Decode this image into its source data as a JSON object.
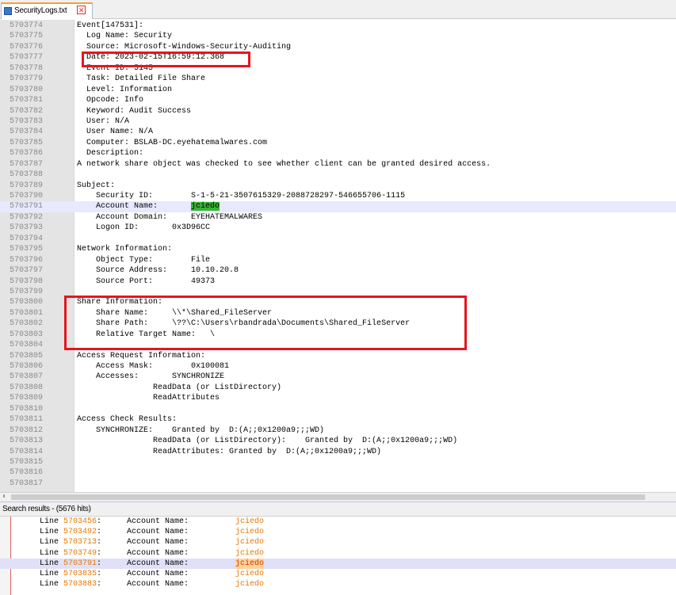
{
  "tab": {
    "filename": "SecurityLogs.txt",
    "close_glyph": "✕"
  },
  "editor": {
    "lines": [
      {
        "num": "5703774",
        "text": "Event[147531]:"
      },
      {
        "num": "5703775",
        "text": "  Log Name: Security"
      },
      {
        "num": "5703776",
        "text": "  Source: Microsoft-Windows-Security-Auditing"
      },
      {
        "num": "5703777",
        "text": "  Date: 2023-02-15T16:59:12.368"
      },
      {
        "num": "5703778",
        "text": "  Event ID: 5145"
      },
      {
        "num": "5703779",
        "text": "  Task: Detailed File Share"
      },
      {
        "num": "5703780",
        "text": "  Level: Information"
      },
      {
        "num": "5703781",
        "text": "  Opcode: Info"
      },
      {
        "num": "5703782",
        "text": "  Keyword: Audit Success"
      },
      {
        "num": "5703783",
        "text": "  User: N/A"
      },
      {
        "num": "5703784",
        "text": "  User Name: N/A"
      },
      {
        "num": "5703785",
        "text": "  Computer: BSLAB-DC.eyehatemalwares.com"
      },
      {
        "num": "5703786",
        "text": "  Description:"
      },
      {
        "num": "5703787",
        "text": "A network share object was checked to see whether client can be granted desired access."
      },
      {
        "num": "5703788",
        "text": ""
      },
      {
        "num": "5703789",
        "text": "Subject:"
      },
      {
        "num": "5703790",
        "text": "    Security ID:        S-1-5-21-3507615329-2088728297-546655706-1115"
      },
      {
        "num": "5703791",
        "text": "    Account Name:       ",
        "token": "jciedo",
        "highlight": true
      },
      {
        "num": "5703792",
        "text": "    Account Domain:     EYEHATEMALWARES"
      },
      {
        "num": "5703793",
        "text": "    Logon ID:       0x3D96CC"
      },
      {
        "num": "5703794",
        "text": ""
      },
      {
        "num": "5703795",
        "text": "Network Information:"
      },
      {
        "num": "5703796",
        "text": "    Object Type:        File"
      },
      {
        "num": "5703797",
        "text": "    Source Address:     10.10.20.8"
      },
      {
        "num": "5703798",
        "text": "    Source Port:        49373"
      },
      {
        "num": "5703799",
        "text": ""
      },
      {
        "num": "5703800",
        "text": "Share Information:"
      },
      {
        "num": "5703801",
        "text": "    Share Name:     \\\\*\\Shared_FileServer"
      },
      {
        "num": "5703802",
        "text": "    Share Path:     \\??\\C:\\Users\\rbandrada\\Documents\\Shared_FileServer"
      },
      {
        "num": "5703803",
        "text": "    Relative Target Name:   \\"
      },
      {
        "num": "5703804",
        "text": ""
      },
      {
        "num": "5703805",
        "text": "Access Request Information:"
      },
      {
        "num": "5703806",
        "text": "    Access Mask:        0x100081"
      },
      {
        "num": "5703807",
        "text": "    Accesses:       SYNCHRONIZE"
      },
      {
        "num": "5703808",
        "text": "                ReadData (or ListDirectory)"
      },
      {
        "num": "5703809",
        "text": "                ReadAttributes"
      },
      {
        "num": "5703810",
        "text": ""
      },
      {
        "num": "5703811",
        "text": "Access Check Results:"
      },
      {
        "num": "5703812",
        "text": "    SYNCHRONIZE:    Granted by  D:(A;;0x1200a9;;;WD)"
      },
      {
        "num": "5703813",
        "text": "                ReadData (or ListDirectory):    Granted by  D:(A;;0x1200a9;;;WD)"
      },
      {
        "num": "5703814",
        "text": "                ReadAttributes: Granted by  D:(A;;0x1200a9;;;WD)"
      },
      {
        "num": "5703815",
        "text": ""
      },
      {
        "num": "5703816",
        "text": ""
      },
      {
        "num": "5703817",
        "text": ""
      }
    ]
  },
  "search": {
    "header": "Search results - (5676 hits)",
    "results": [
      {
        "line": "5703456",
        "field": "Account Name:",
        "value": "jciedo"
      },
      {
        "line": "5703492",
        "field": "Account Name:",
        "value": "jciedo"
      },
      {
        "line": "5703713",
        "field": "Account Name:",
        "value": "jciedo"
      },
      {
        "line": "5703749",
        "field": "Account Name:",
        "value": "jciedo"
      },
      {
        "line": "5703791",
        "field": "Account Name:",
        "value": "jciedo",
        "selected": true
      },
      {
        "line": "5703835",
        "field": "Account Name:",
        "value": "jciedo"
      },
      {
        "line": "5703883",
        "field": "Account Name:",
        "value": "jciedo"
      }
    ]
  },
  "colors": {
    "annotation_box": "#e8141e",
    "match_green": "#36b336",
    "hit_orange": "#e87800"
  }
}
